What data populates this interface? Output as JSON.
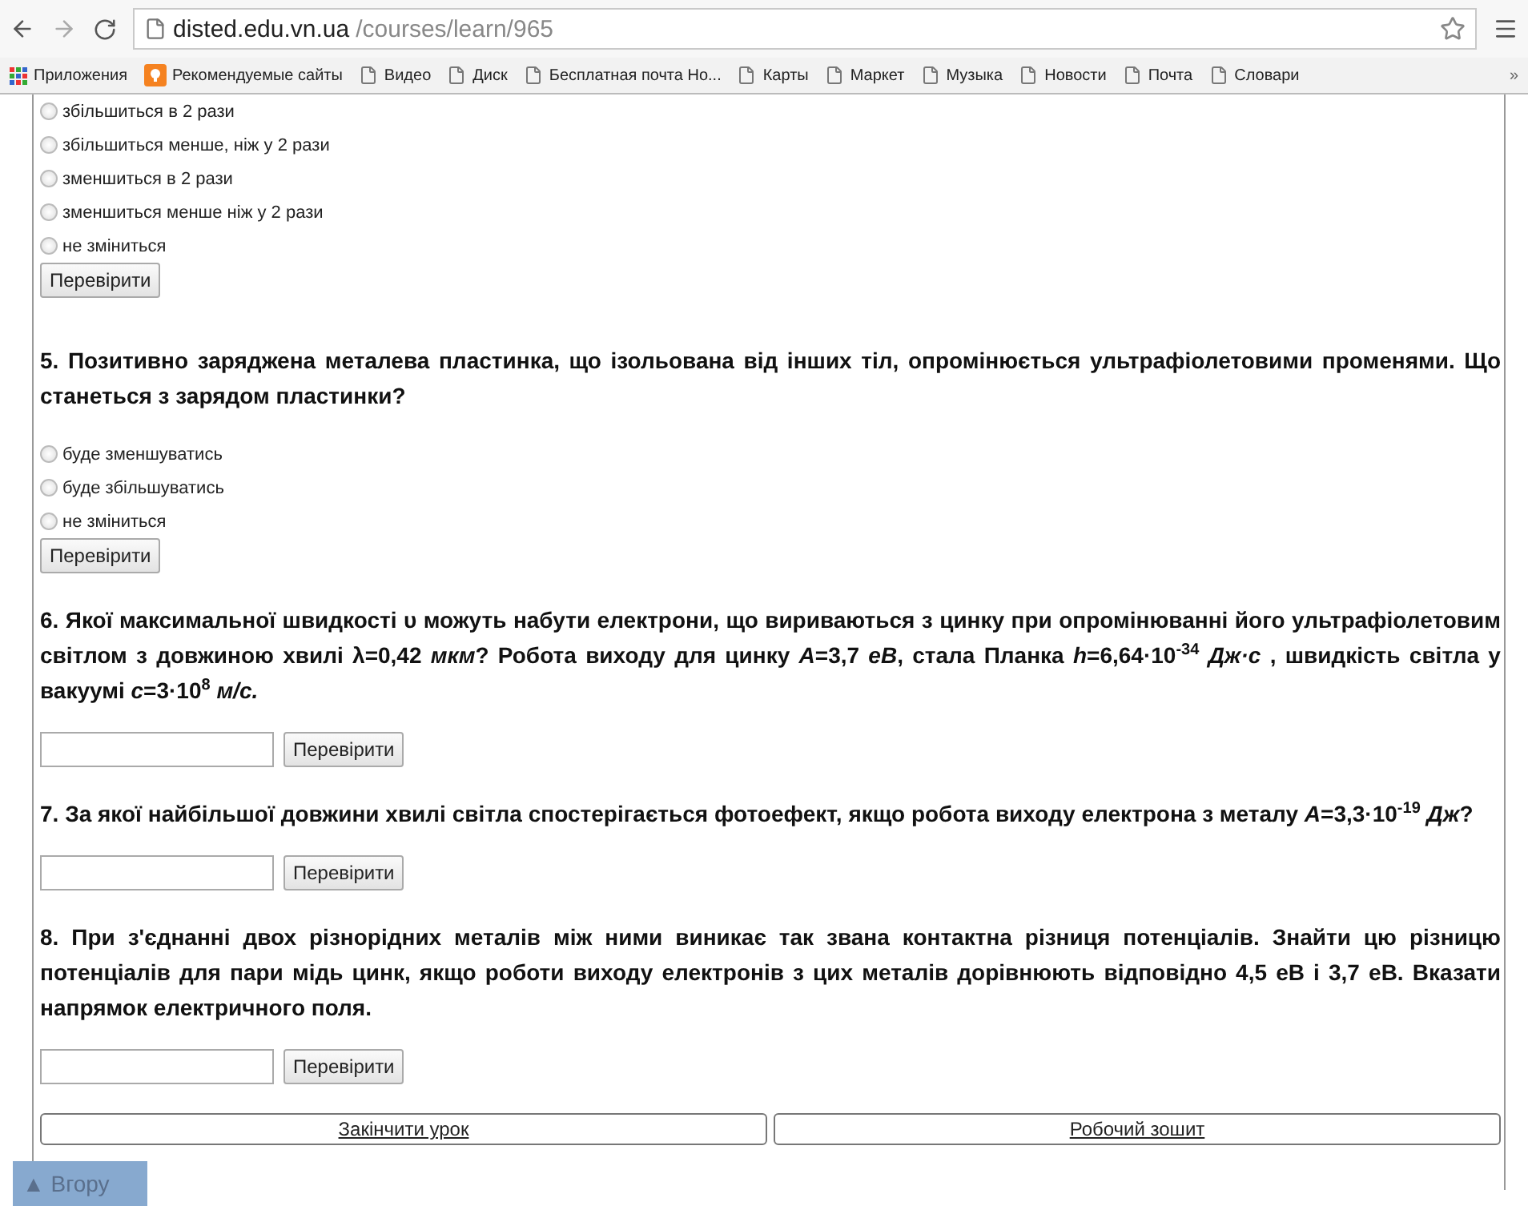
{
  "browser": {
    "url_host": "disted.edu.vn.ua",
    "url_path": "/courses/learn/965"
  },
  "bookmarks": [
    {
      "kind": "apps",
      "label": "Приложения"
    },
    {
      "kind": "recommended",
      "label": "Рекомендуемые сайты"
    },
    {
      "kind": "page",
      "label": "Видео"
    },
    {
      "kind": "page",
      "label": "Диск"
    },
    {
      "kind": "page",
      "label": "Бесплатная почта Но..."
    },
    {
      "kind": "page",
      "label": "Карты"
    },
    {
      "kind": "page",
      "label": "Маркет"
    },
    {
      "kind": "page",
      "label": "Музыка"
    },
    {
      "kind": "page",
      "label": "Новости"
    },
    {
      "kind": "page",
      "label": "Почта"
    },
    {
      "kind": "page",
      "label": "Словари"
    }
  ],
  "bookmarks_overflow": "»",
  "questions": [
    {
      "kind": "choice",
      "options": [
        {
          "label": "збільшиться в 2 рази",
          "selected": false
        },
        {
          "label": "збільшиться менше, ніж у 2 рази",
          "selected": false
        },
        {
          "label": "зменшиться в 2 рази",
          "selected": false
        },
        {
          "label": "зменшиться менше  ніж у 2 рази",
          "selected": false
        },
        {
          "label": "не зміниться",
          "selected": false
        }
      ],
      "button": "Перевірити"
    },
    {
      "kind": "choice",
      "text": "5. Позитивно заряджена металева пластинка, що ізольована від інших тіл, опромінюється ультрафіолетовими променями. Що станеться з зарядом пластинки?",
      "options": [
        {
          "label": "буде зменшуватись",
          "selected": false
        },
        {
          "label": "буде збільшуватись",
          "selected": false
        },
        {
          "label": "не зміниться",
          "selected": false
        }
      ],
      "button": "Перевірити"
    },
    {
      "kind": "input",
      "text": "6. Якої максимальної швидкості υ можуть набути електрони, що вириваються з цинку при опромінюванні його ультрафіолетовим світлом з довжиною хвилі λ=0,42 *мкм*?  Робота виходу для цинку *A*=3,7 *еВ*, стала Планка *h*=6,64·10$^{-34}$ *Дж·с* , швидкість світла у вакуумі *c*=3·10$^{8}$ *м/с.*",
      "button": "Перевірити"
    },
    {
      "kind": "input",
      "text": "7. За якої найбільшої довжини хвилі світла спостерігається фотоефект, якщо робота виходу електрона з металу *A*=3,3·10$^{-19}$ *Дж*?",
      "button": "Перевірити"
    },
    {
      "kind": "input",
      "text": "8. При з'єднанні двох різнорідних металів між ними виникає так звана контактна різниця потенціалів. Знайти цю різницю потенціалів для пари мідь цинк, якщо роботи виходу електронів з цих металів дорівнюють відповідно 4,5 еВ  і 3,7 еВ. Вказати напрямок електричного поля.",
      "button": "Перевірити"
    }
  ],
  "footer_links": [
    "Закінчити урок",
    "Робочий зошит"
  ],
  "scroll_top": "▲ Вгору"
}
